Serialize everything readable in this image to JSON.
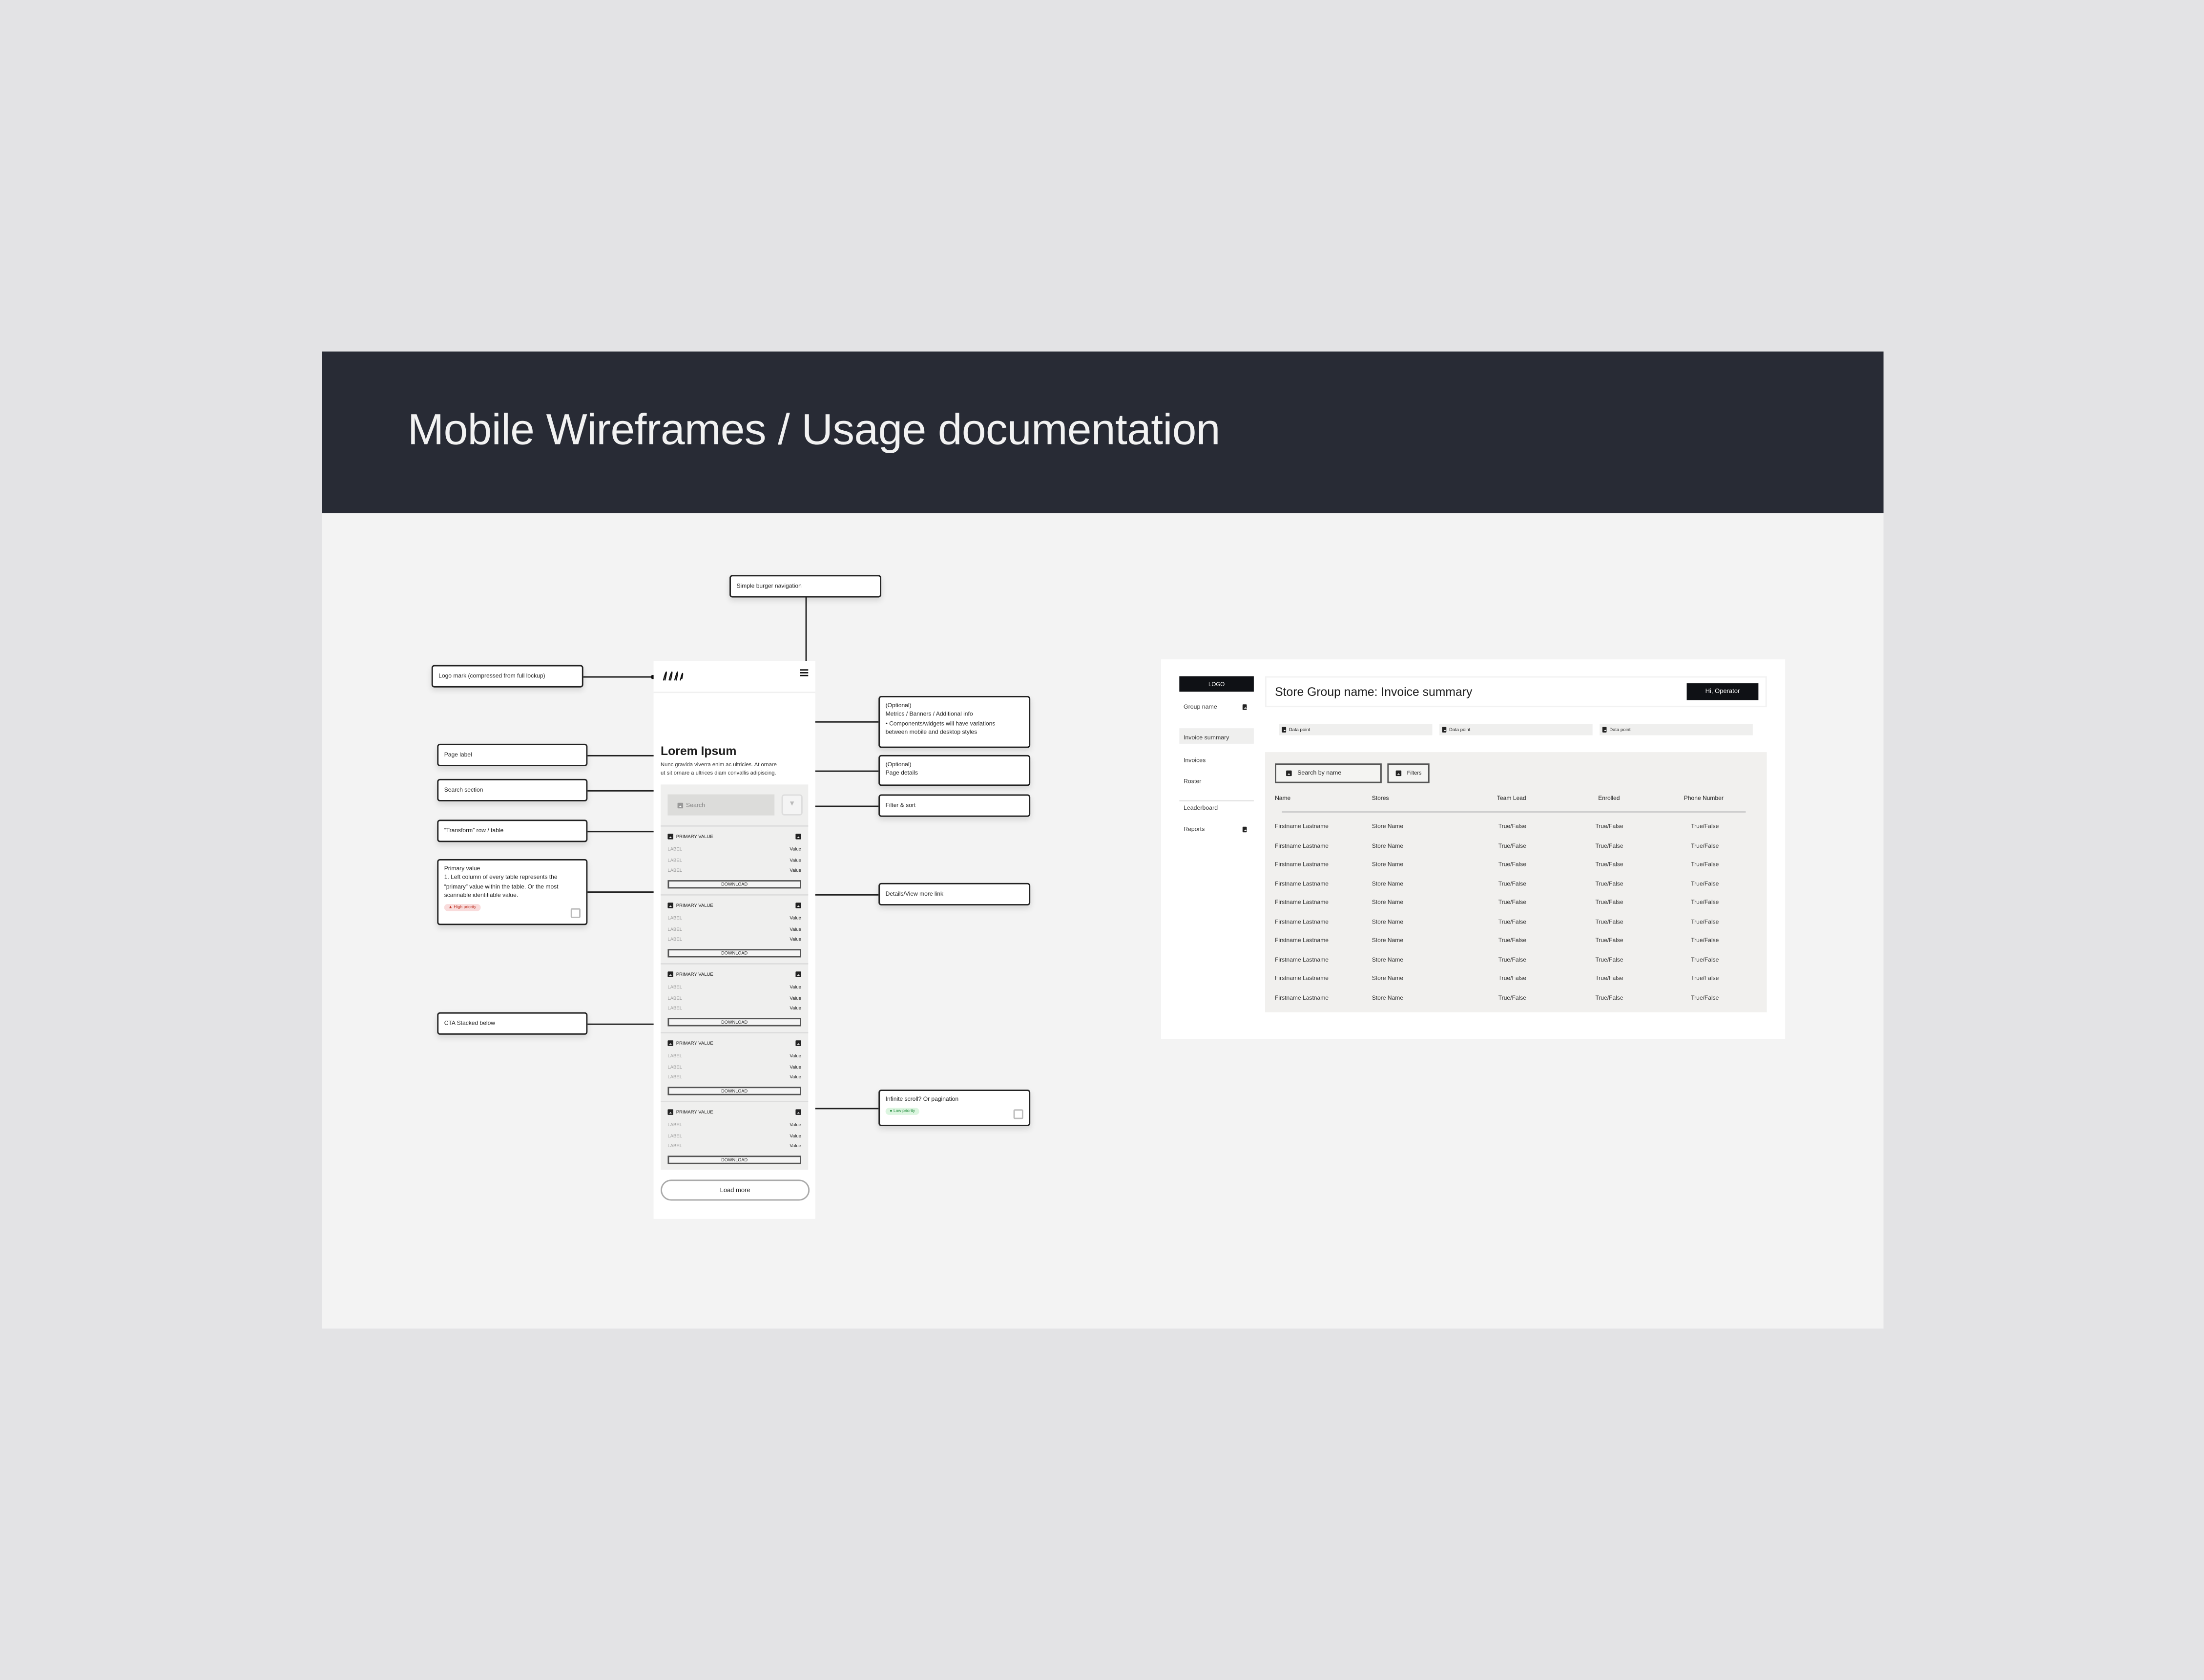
{
  "page_title": "Mobile Wireframes / Usage documentation",
  "colors": {
    "header_bg": "#282b35",
    "canvas_bg": "#f3f3f3",
    "high_priority": "#f9dcdc",
    "low_priority": "#dcf5e0"
  },
  "annotations": {
    "burger": "Simple burger navigation",
    "logo": "Logo mark (compressed from full lockup)",
    "metrics": [
      "(Optional)",
      "Metrics / Banners / Additional info",
      "• Components/widgets will have variations",
      "between mobile and desktop styles"
    ],
    "page_label": "Page label",
    "page_details": [
      "(Optional)",
      "Page details"
    ],
    "search_section": "Search section",
    "filter_sort": "Filter & sort",
    "transform": "“Transform” row / table",
    "primary_value": [
      "Primary value",
      "1. Left column of every table represents the",
      "“primary” value within the table. Or the most",
      "scannable identifiable value."
    ],
    "high_priority": "▲ High priority",
    "details_link": "Details/View more link",
    "cta": "CTA Stacked below",
    "infinite": "Infinite scroll? Or pagination",
    "low_priority": "● Low priority"
  },
  "mobile": {
    "logo_icon": "scribble-logo-icon",
    "menu_icon": "burger-menu-icon",
    "heading": "Lorem Ipsum",
    "description": [
      "Nunc gravida viverra enim ac ultricies. At ornare",
      "ut sit ornare a ultrices diam convallis adipiscing."
    ],
    "search_placeholder": "Search",
    "filter_icon": "filter-icon",
    "cards": [
      {
        "primary": "PRIMARY VALUE",
        "rows": [
          {
            "label": "LABEL",
            "value": "Value"
          },
          {
            "label": "LABEL",
            "value": "Value"
          },
          {
            "label": "LABEL",
            "value": "Value"
          }
        ],
        "cta": "DOWNLOAD"
      },
      {
        "primary": "PRIMARY VALUE",
        "rows": [
          {
            "label": "LABEL",
            "value": "Value"
          },
          {
            "label": "LABEL",
            "value": "Value"
          },
          {
            "label": "LABEL",
            "value": "Value"
          }
        ],
        "cta": "DOWNLOAD"
      },
      {
        "primary": "PRIMARY VALUE",
        "rows": [
          {
            "label": "LABEL",
            "value": "Value"
          },
          {
            "label": "LABEL",
            "value": "Value"
          },
          {
            "label": "LABEL",
            "value": "Value"
          }
        ],
        "cta": "DOWNLOAD"
      },
      {
        "primary": "PRIMARY VALUE",
        "rows": [
          {
            "label": "LABEL",
            "value": "Value"
          },
          {
            "label": "LABEL",
            "value": "Value"
          },
          {
            "label": "LABEL",
            "value": "Value"
          }
        ],
        "cta": "DOWNLOAD"
      },
      {
        "primary": "PRIMARY VALUE",
        "rows": [
          {
            "label": "LABEL",
            "value": "Value"
          },
          {
            "label": "LABEL",
            "value": "Value"
          },
          {
            "label": "LABEL",
            "value": "Value"
          }
        ],
        "cta": "DOWNLOAD"
      }
    ],
    "load_more": "Load more"
  },
  "desktop": {
    "logo": "LOGO",
    "sidebar": [
      {
        "label": "Group name",
        "icon": true
      },
      {
        "label": "Invoice summary",
        "active": true
      },
      {
        "label": "Invoices"
      },
      {
        "label": "Roster"
      },
      {
        "label": "Leaderboard"
      },
      {
        "label": "Reports",
        "icon": true
      }
    ],
    "title": "Store Group name: Invoice summary",
    "user_button": "Hi, Operator",
    "data_points": [
      "Data point",
      "Data point",
      "Data point"
    ],
    "search_placeholder": "Search by name",
    "filters": "Filters",
    "columns": [
      "Name",
      "Stores",
      "Team Lead",
      "Enrolled",
      "Phone Number"
    ],
    "rows": [
      [
        "Firstname Lastname",
        "Store Name",
        "True/False",
        "True/False",
        "True/False"
      ],
      [
        "Firstname Lastname",
        "Store Name",
        "True/False",
        "True/False",
        "True/False"
      ],
      [
        "Firstname Lastname",
        "Store Name",
        "True/False",
        "True/False",
        "True/False"
      ],
      [
        "Firstname Lastname",
        "Store Name",
        "True/False",
        "True/False",
        "True/False"
      ],
      [
        "Firstname Lastname",
        "Store Name",
        "True/False",
        "True/False",
        "True/False"
      ],
      [
        "Firstname Lastname",
        "Store Name",
        "True/False",
        "True/False",
        "True/False"
      ],
      [
        "Firstname Lastname",
        "Store Name",
        "True/False",
        "True/False",
        "True/False"
      ],
      [
        "Firstname Lastname",
        "Store Name",
        "True/False",
        "True/False",
        "True/False"
      ],
      [
        "Firstname Lastname",
        "Store Name",
        "True/False",
        "True/False",
        "True/False"
      ],
      [
        "Firstname Lastname",
        "Store Name",
        "True/False",
        "True/False",
        "True/False"
      ]
    ]
  }
}
